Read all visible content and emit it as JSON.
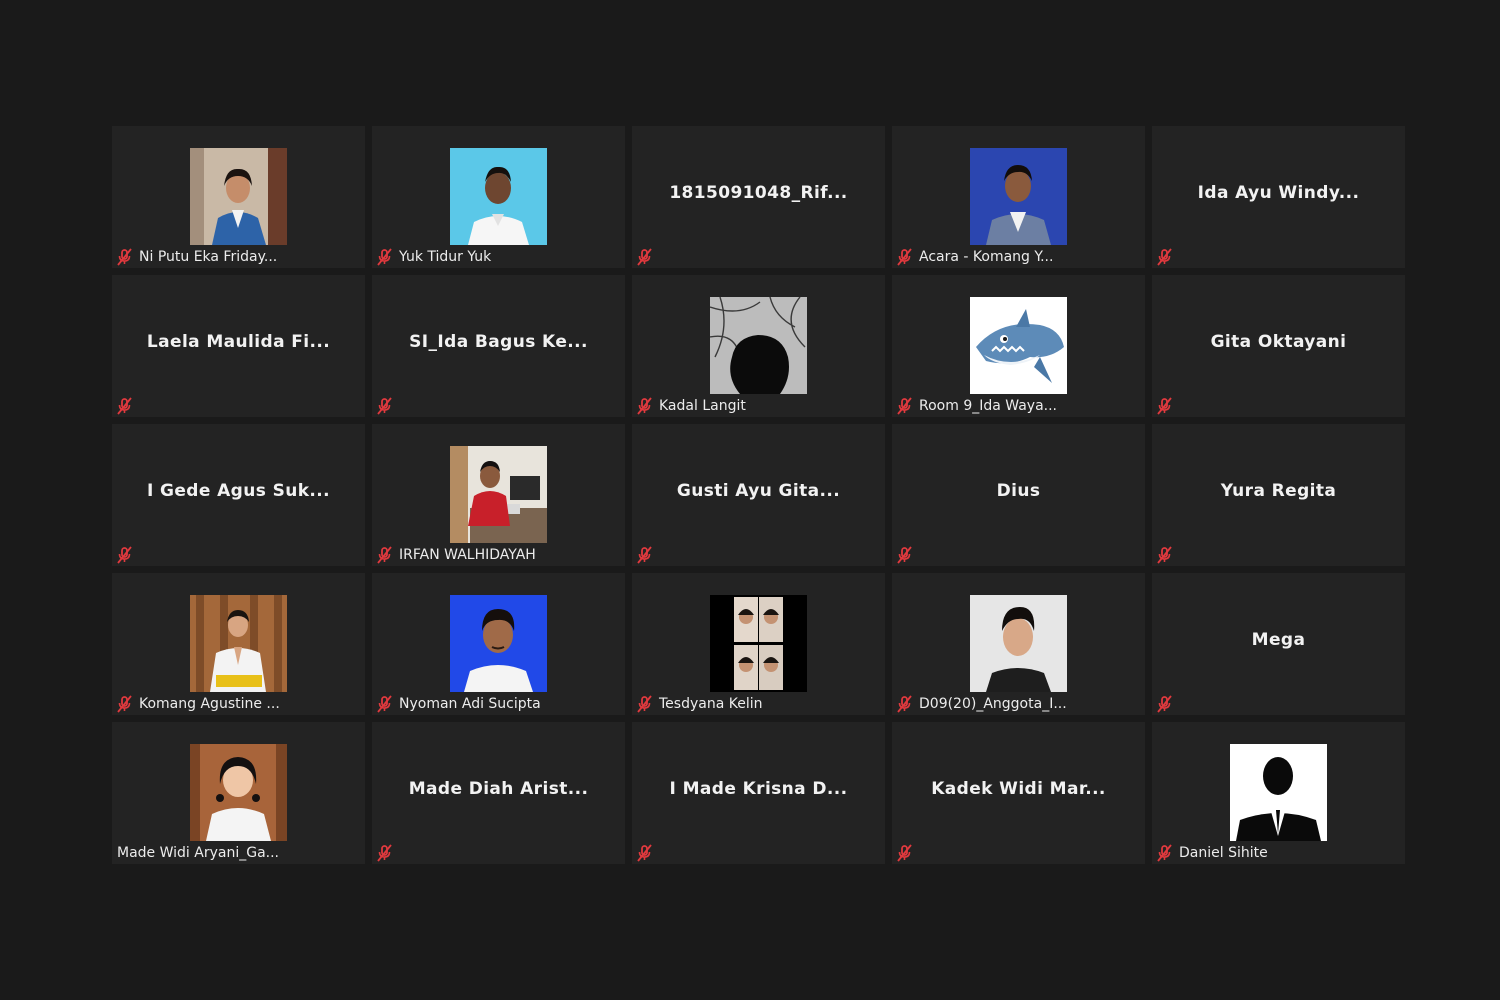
{
  "colors": {
    "background": "#1a1a1a",
    "tile": "#232323",
    "mute_icon": "#e0393e",
    "text": "#ececec"
  },
  "participants": [
    {
      "id": "p1",
      "display_name": "",
      "label": "Ni Putu Eka Friday...",
      "photo": "woman-blue-blazer",
      "muted": true
    },
    {
      "id": "p2",
      "display_name": "",
      "label": "Yuk Tidur Yuk",
      "photo": "man-white-shirt-cyan-bg",
      "muted": true
    },
    {
      "id": "p3",
      "display_name": "1815091048_Rif...",
      "label": "",
      "photo": null,
      "muted": true
    },
    {
      "id": "p4",
      "display_name": "",
      "label": "Acara - Komang Y...",
      "photo": "man-blue-suit-blue-bg",
      "muted": true
    },
    {
      "id": "p5",
      "display_name": "Ida Ayu Windy...",
      "label": "",
      "photo": null,
      "muted": true
    },
    {
      "id": "p6",
      "display_name": "Laela Maulida Fi...",
      "label": "",
      "photo": null,
      "muted": true
    },
    {
      "id": "p7",
      "display_name": "SI_Ida Bagus Ke...",
      "label": "",
      "photo": null,
      "muted": true
    },
    {
      "id": "p8",
      "display_name": "",
      "label": "Kadal Langit",
      "photo": "silhouette-grayscale",
      "muted": true
    },
    {
      "id": "p9",
      "display_name": "",
      "label": "Room 9_Ida Waya...",
      "photo": "cartoon-shark",
      "muted": true
    },
    {
      "id": "p10",
      "display_name": "Gita Oktayani",
      "label": "",
      "photo": null,
      "muted": true
    },
    {
      "id": "p11",
      "display_name": "I Gede Agus Suk...",
      "label": "",
      "photo": null,
      "muted": true
    },
    {
      "id": "p12",
      "display_name": "",
      "label": "IRFAN WALHIDAYAH",
      "photo": "man-at-desk",
      "muted": true
    },
    {
      "id": "p13",
      "display_name": "Gusti Ayu Gita...",
      "label": "",
      "photo": null,
      "muted": true
    },
    {
      "id": "p14",
      "display_name": "Dius",
      "label": "",
      "photo": null,
      "muted": true
    },
    {
      "id": "p15",
      "display_name": "Yura Regita",
      "label": "",
      "photo": null,
      "muted": true
    },
    {
      "id": "p16",
      "display_name": "",
      "label": "Komang Agustine ...",
      "photo": "woman-traditional-dress",
      "muted": true
    },
    {
      "id": "p17",
      "display_name": "",
      "label": "Nyoman Adi Sucipta",
      "photo": "man-blue-bg",
      "muted": true
    },
    {
      "id": "p18",
      "display_name": "",
      "label": "Tesdyana Kelin",
      "photo": "photo-collage",
      "muted": true
    },
    {
      "id": "p19",
      "display_name": "",
      "label": "D09(20)_Anggota_I...",
      "photo": "man-dark-shirt",
      "muted": true
    },
    {
      "id": "p20",
      "display_name": "Mega",
      "label": "",
      "photo": null,
      "muted": true
    },
    {
      "id": "p21",
      "display_name": "",
      "label": "Made Widi Aryani_Ga...",
      "photo": "woman-white-shirt",
      "muted": false
    },
    {
      "id": "p22",
      "display_name": "Made Diah Arist...",
      "label": "",
      "photo": null,
      "muted": true
    },
    {
      "id": "p23",
      "display_name": "I Made Krisna D...",
      "label": "",
      "photo": null,
      "muted": true
    },
    {
      "id": "p24",
      "display_name": "Kadek Widi Mar...",
      "label": "",
      "photo": null,
      "muted": true
    },
    {
      "id": "p25",
      "display_name": "",
      "label": "Daniel Sihite",
      "photo": "suit-silhouette",
      "muted": true
    }
  ]
}
